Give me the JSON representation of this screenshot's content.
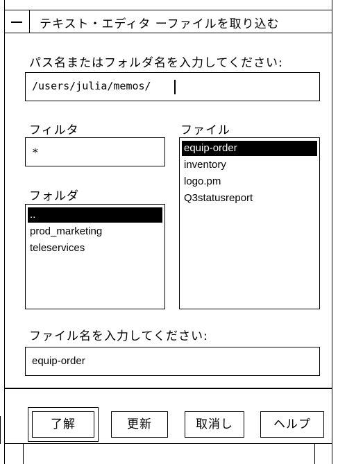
{
  "window": {
    "title": "テキスト・エディタ ーファイルを取り込む"
  },
  "path": {
    "label": "パス名またはフォルダ名を入力してください:",
    "value": "/users/julia/memos/"
  },
  "filter": {
    "label": "フィルタ",
    "value": "*"
  },
  "folders": {
    "label": "フォルダ",
    "items": [
      "..",
      "prod_marketing",
      "teleservices"
    ],
    "selected_index": 0
  },
  "files": {
    "label": "ファイル",
    "items": [
      "equip-order",
      "inventory",
      "logo.pm",
      "Q3statusreport"
    ],
    "selected_index": 0
  },
  "filename": {
    "label": "ファイル名を入力してください:",
    "value": "equip-order"
  },
  "buttons": {
    "ok": "了解",
    "update": "更新",
    "cancel": "取消し",
    "help": "ヘルプ"
  }
}
